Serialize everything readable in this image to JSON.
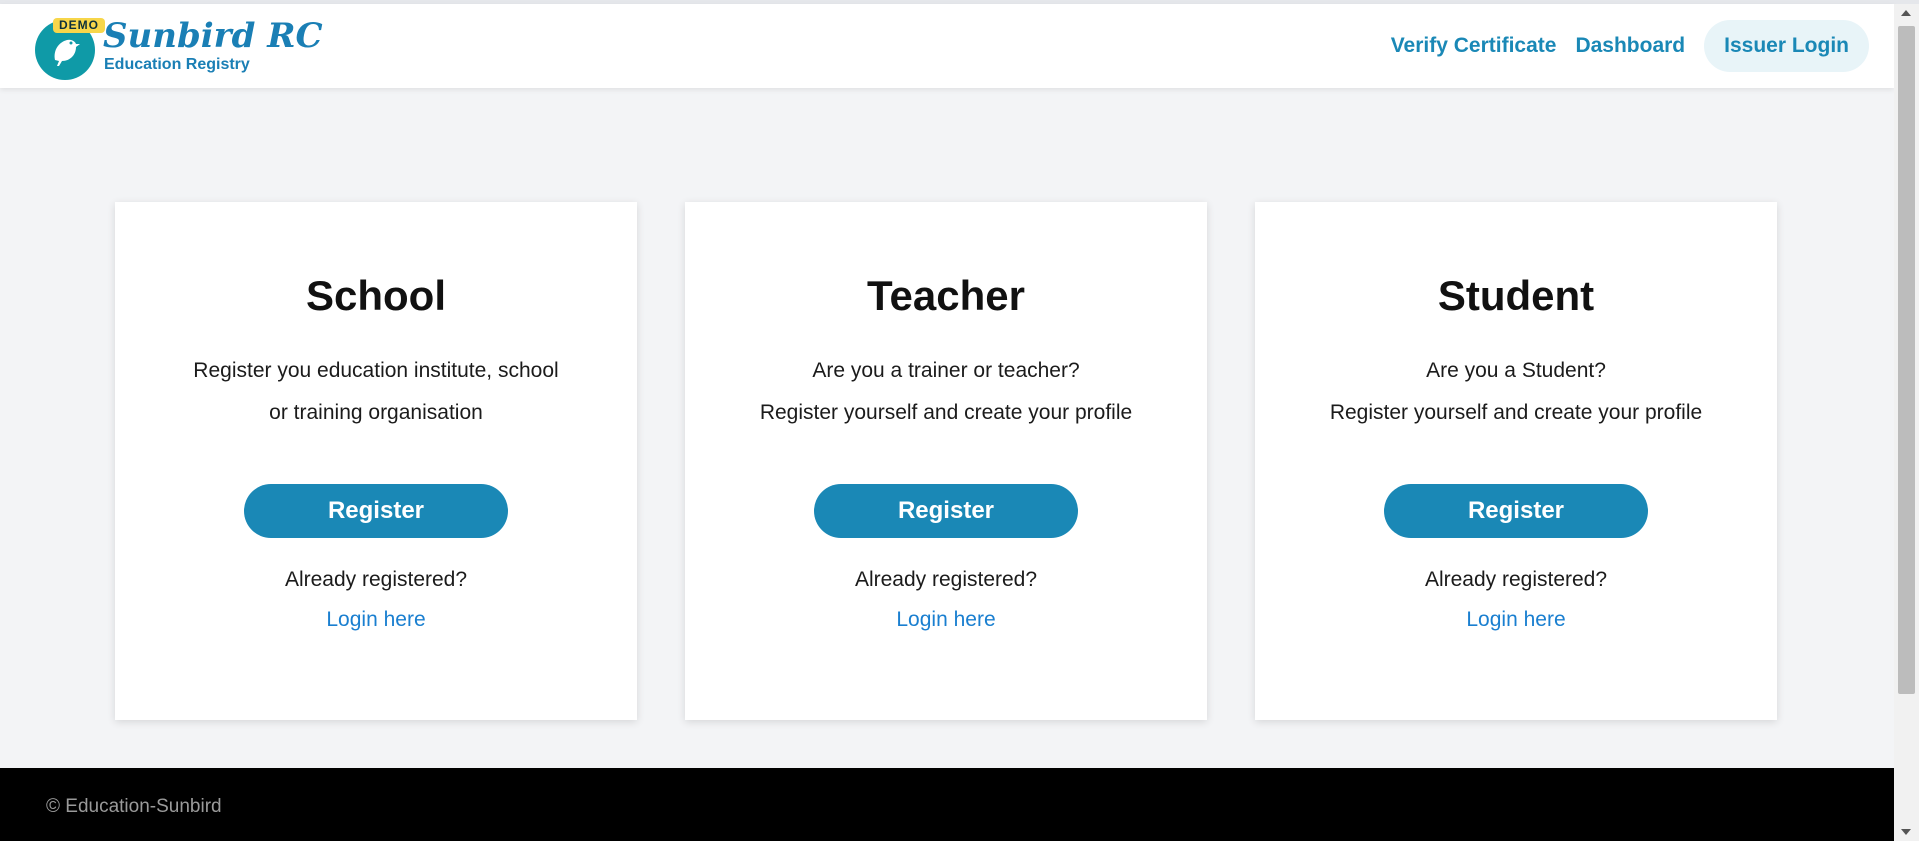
{
  "header": {
    "badge": "DEMO",
    "brand_name": "Sunbird RC",
    "brand_sub": "Education Registry",
    "nav": {
      "verify": "Verify Certificate",
      "dashboard": "Dashboard",
      "issuer_login": "Issuer Login"
    }
  },
  "cards": [
    {
      "title": "School",
      "desc_line1": "Register you education institute, school",
      "desc_line2": "or training organisation",
      "button": "Register",
      "already": "Already registered?",
      "login": "Login here"
    },
    {
      "title": "Teacher",
      "desc_line1": "Are you a trainer or teacher?",
      "desc_line2": "Register yourself and create your profile",
      "button": "Register",
      "already": "Already registered?",
      "login": "Login here"
    },
    {
      "title": "Student",
      "desc_line1": "Are you a Student?",
      "desc_line2": "Register yourself and create your profile",
      "button": "Register",
      "already": "Already registered?",
      "login": "Login here"
    }
  ],
  "footer": {
    "copyright": "© Education-Sunbird"
  },
  "colors": {
    "primary": "#1a88b6",
    "link": "#1a7fd0",
    "logo_teal": "#0f9aa7",
    "badge_yellow": "#f7d64a"
  }
}
